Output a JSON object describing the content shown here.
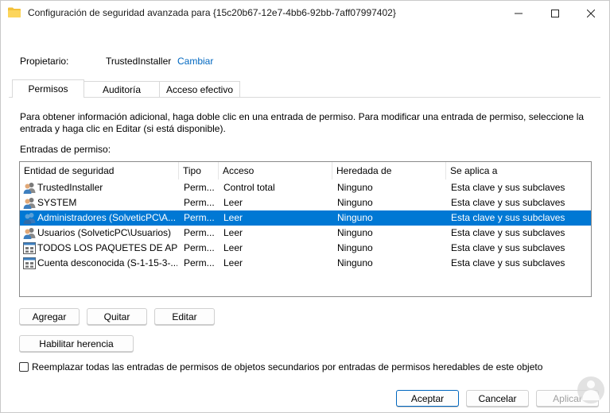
{
  "window": {
    "title": "Configuración de seguridad avanzada para {15c20b67-12e7-4bb6-92bb-7aff07997402}"
  },
  "owner": {
    "label": "Propietario:",
    "value": "TrustedInstaller",
    "change_link": "Cambiar"
  },
  "tabs": [
    {
      "label": "Permisos",
      "active": true
    },
    {
      "label": "Auditoría",
      "active": false
    },
    {
      "label": "Acceso efectivo",
      "active": false
    }
  ],
  "info_text": "Para obtener información adicional, haga doble clic en una entrada de permiso. Para modificar una entrada de permiso, seleccione la entrada y haga clic en Editar (si está disponible).",
  "entries_label": "Entradas de permiso:",
  "table": {
    "headers": [
      "Entidad de seguridad",
      "Tipo",
      "Acceso",
      "Heredada de",
      "Se aplica a"
    ],
    "rows": [
      {
        "entity": "TrustedInstaller",
        "type": "Perm...",
        "access": "Control total",
        "inherited": "Ninguno",
        "applies": "Esta clave y sus subclaves",
        "icon": "users-icon",
        "selected": false
      },
      {
        "entity": "SYSTEM",
        "type": "Perm...",
        "access": "Leer",
        "inherited": "Ninguno",
        "applies": "Esta clave y sus subclaves",
        "icon": "users-icon",
        "selected": false
      },
      {
        "entity": "Administradores (SolveticPC\\A...",
        "type": "Perm...",
        "access": "Leer",
        "inherited": "Ninguno",
        "applies": "Esta clave y sus subclaves",
        "icon": "users-icon",
        "selected": true
      },
      {
        "entity": "Usuarios (SolveticPC\\Usuarios)",
        "type": "Perm...",
        "access": "Leer",
        "inherited": "Ninguno",
        "applies": "Esta clave y sus subclaves",
        "icon": "users-icon",
        "selected": false
      },
      {
        "entity": "TODOS LOS PAQUETES DE APLI...",
        "type": "Perm...",
        "access": "Leer",
        "inherited": "Ninguno",
        "applies": "Esta clave y sus subclaves",
        "icon": "app-package-icon",
        "selected": false
      },
      {
        "entity": "Cuenta desconocida (S-1-15-3-...",
        "type": "Perm...",
        "access": "Leer",
        "inherited": "Ninguno",
        "applies": "Esta clave y sus subclaves",
        "icon": "app-package-icon",
        "selected": false
      }
    ]
  },
  "buttons": {
    "add": "Agregar",
    "remove": "Quitar",
    "edit": "Editar",
    "inheritance": "Habilitar herencia",
    "ok": "Aceptar",
    "cancel": "Cancelar",
    "apply": "Aplicar"
  },
  "replace_checkbox": {
    "label": "Reemplazar todas las entradas de permisos de objetos secundarios por entradas de permisos heredables de este objeto",
    "checked": false
  },
  "colors": {
    "selection": "#0078d4",
    "link": "#0067c0"
  }
}
